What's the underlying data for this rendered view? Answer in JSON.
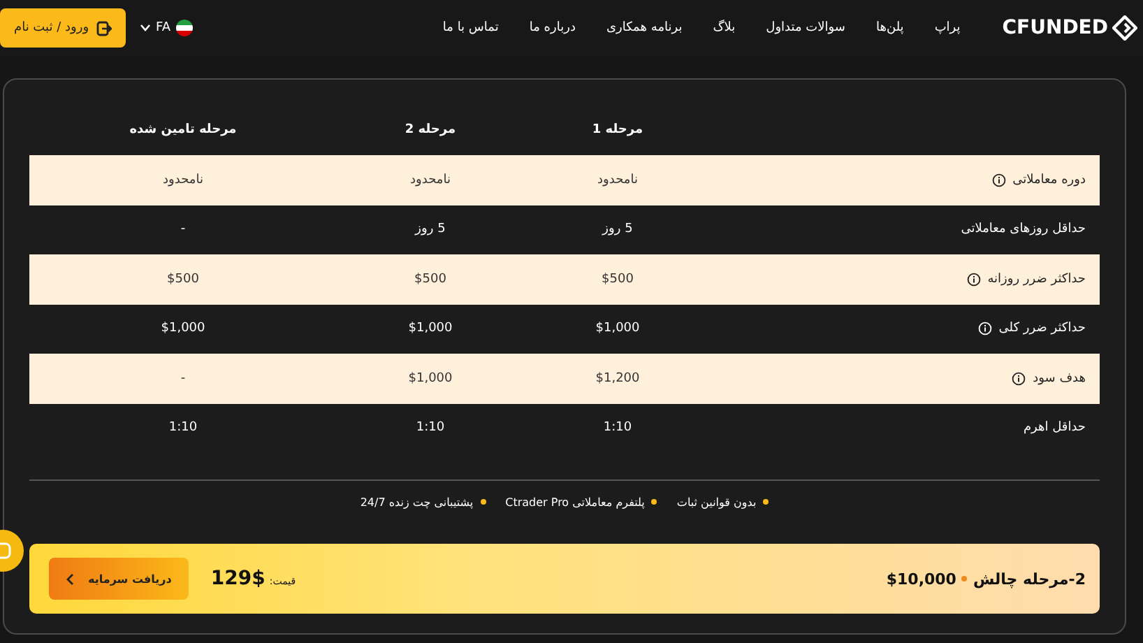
{
  "header": {
    "logo": "CFUNDED",
    "nav": [
      {
        "label": "پراپ"
      },
      {
        "label": "پلن‌ها"
      },
      {
        "label": "سوالات متداول"
      },
      {
        "label": "بلاگ"
      },
      {
        "label": "برنامه همکاری"
      },
      {
        "label": "درباره ما"
      },
      {
        "label": "تماس با ما"
      }
    ],
    "language": "FA",
    "login": "ورود / ثبت نام"
  },
  "table": {
    "columns": [
      "مرحله 1",
      "مرحله 2",
      "مرحله تامین شده"
    ],
    "rows": [
      {
        "label": "دوره معاملاتی",
        "info": true,
        "cells": [
          "نامحدود",
          "نامحدود",
          "نامحدود"
        ]
      },
      {
        "label": "حداقل روزهای معاملاتی",
        "info": false,
        "cells": [
          "5 روز",
          "5 روز",
          "-"
        ]
      },
      {
        "label": "حداکثر ضرر روزانه",
        "info": true,
        "cells": [
          "$500",
          "$500",
          "$500"
        ]
      },
      {
        "label": "حداکثر ضرر کلی",
        "info": true,
        "cells": [
          "$1,000",
          "$1,000",
          "$1,000"
        ]
      },
      {
        "label": "هدف سود",
        "info": true,
        "cells": [
          "$1,200",
          "$1,000",
          "-"
        ]
      },
      {
        "label": "حداقل اهرم",
        "info": false,
        "cells": [
          "1:10",
          "1:10",
          "1:10"
        ]
      }
    ]
  },
  "features": [
    "بدون قوانین ثبات",
    "پلتفرم معاملاتی Ctrader Pro",
    "پشتیبانی چت زنده 24/7"
  ],
  "plan_bar": {
    "plan": "2-مرحله چالش",
    "amount": "$10,000",
    "price_label": "قیمت:",
    "price": "129$",
    "button": "دریافت سرمایه"
  }
}
